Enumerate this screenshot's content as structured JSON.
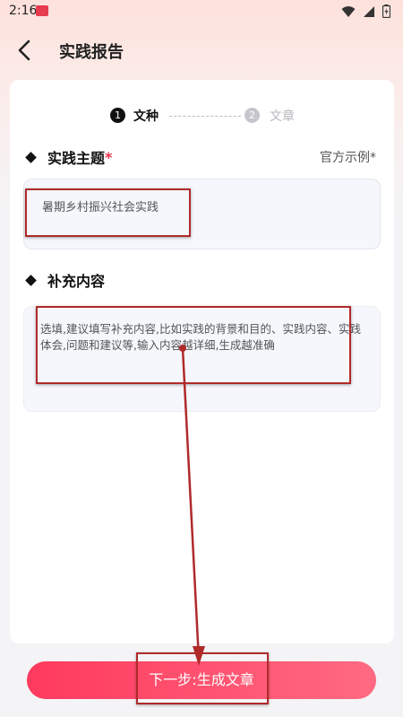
{
  "status_bar": {
    "time": "2:16",
    "icons": [
      "wifi-icon",
      "signal-icon",
      "battery-icon"
    ]
  },
  "header": {
    "title": "实践报告",
    "back_icon": "back-arrow-icon"
  },
  "stepper": {
    "steps": [
      {
        "number": "1",
        "label": "文种",
        "active": true
      },
      {
        "number": "2",
        "label": "文章",
        "active": false
      }
    ]
  },
  "topic": {
    "label": "实践主题",
    "required_mark": "*",
    "example_link": "官方示例*",
    "value": "暑期乡村振兴社会实践"
  },
  "supplement": {
    "label": "补充内容",
    "placeholder": "选填,建议填写补充内容,比如实践的背景和目的、实践内容、实践体会,问题和建议等,输入内容越详细,生成越准确"
  },
  "footer": {
    "next_button": "下一步:生成文章"
  },
  "colors": {
    "accent": "#ff3a5e",
    "required": "#e8304a",
    "annotation": "#b02a2a"
  }
}
